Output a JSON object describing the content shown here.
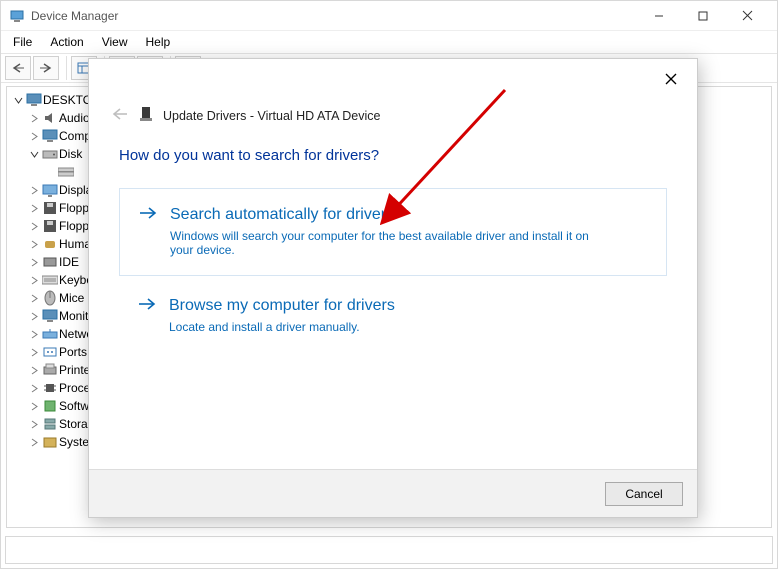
{
  "dm": {
    "title": "Device Manager",
    "menu": {
      "file": "File",
      "action": "Action",
      "view": "View",
      "help": "Help"
    },
    "root": "DESKTOP",
    "nodes": [
      {
        "exp": ">",
        "icon": "speaker",
        "label": "Audio"
      },
      {
        "exp": ">",
        "icon": "monitor",
        "label": "Computer"
      },
      {
        "exp": "v",
        "icon": "disk",
        "label": "Disk"
      },
      {
        "exp": "",
        "icon": "drive",
        "label": "",
        "indent": 2,
        "noExp": true
      },
      {
        "exp": ">",
        "icon": "display",
        "label": "Display"
      },
      {
        "exp": ">",
        "icon": "floppy",
        "label": "Floppy"
      },
      {
        "exp": ">",
        "icon": "floppy",
        "label": "Floppy"
      },
      {
        "exp": ">",
        "icon": "hid",
        "label": "Human"
      },
      {
        "exp": ">",
        "icon": "ide",
        "label": "IDE"
      },
      {
        "exp": ">",
        "icon": "keyboard",
        "label": "Keyboard"
      },
      {
        "exp": ">",
        "icon": "mouse",
        "label": "Mice"
      },
      {
        "exp": ">",
        "icon": "monitor",
        "label": "Monitor"
      },
      {
        "exp": ">",
        "icon": "network",
        "label": "Network"
      },
      {
        "exp": ">",
        "icon": "port",
        "label": "Ports"
      },
      {
        "exp": ">",
        "icon": "printer",
        "label": "Printer"
      },
      {
        "exp": ">",
        "icon": "cpu",
        "label": "Processors"
      },
      {
        "exp": ">",
        "icon": "software",
        "label": "Software"
      },
      {
        "exp": ">",
        "icon": "storage",
        "label": "Storage"
      },
      {
        "exp": ">",
        "icon": "system",
        "label": "System"
      }
    ]
  },
  "dialog": {
    "title": "Update Drivers - Virtual HD ATA Device",
    "heading": "How do you want to search for drivers?",
    "opt1": {
      "title": "Search automatically for drivers",
      "desc": "Windows will search your computer for the best available driver and install it on your device."
    },
    "opt2": {
      "title": "Browse my computer for drivers",
      "desc": "Locate and install a driver manually."
    },
    "cancel": "Cancel"
  }
}
